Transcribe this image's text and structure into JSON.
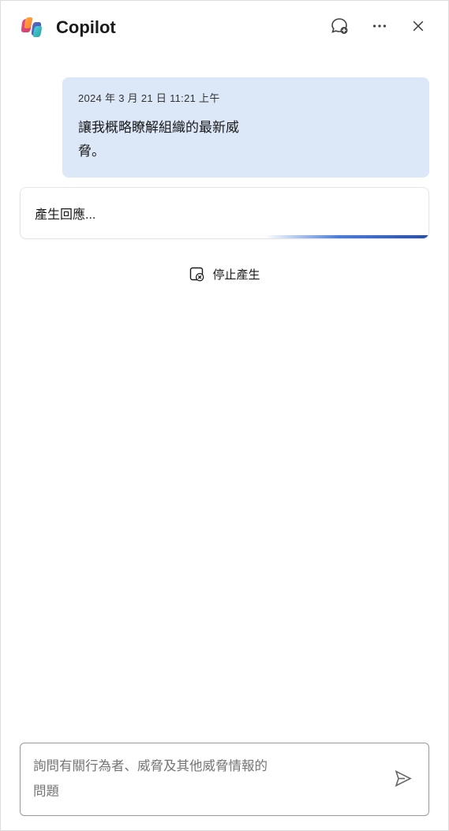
{
  "header": {
    "title": "Copilot"
  },
  "chat": {
    "user_message": {
      "timestamp": "2024 年 3 月 21 日 11:21  上午",
      "text": "讓我概略瞭解組織的最新威脅。"
    },
    "response_status": "產生回應...",
    "stop_label": "停止產生"
  },
  "input": {
    "placeholder": "詢問有關行為者、威脅及其他威脅情報的問題"
  }
}
